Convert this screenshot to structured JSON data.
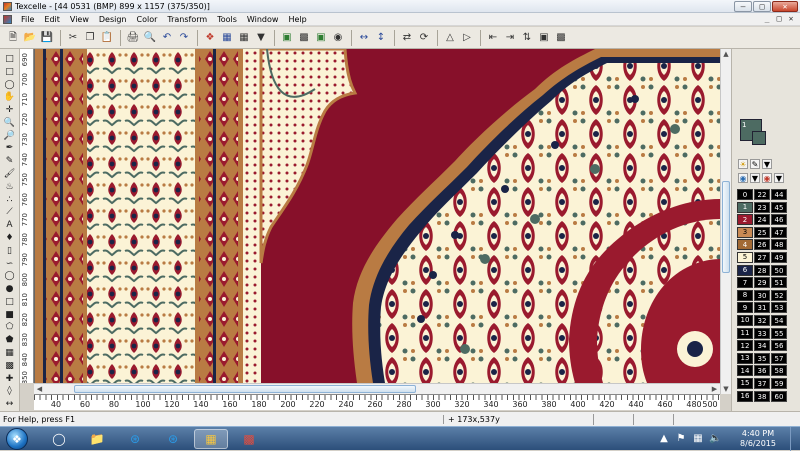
{
  "window": {
    "title": "Texcelle - [44 0531 (BMP) 899 x 1157 (375/350)]",
    "minimize_glyph": "—",
    "maximize_glyph": "□",
    "close_glyph": "✕"
  },
  "menu": {
    "items": [
      "File",
      "Edit",
      "View",
      "Design",
      "Color",
      "Transform",
      "Tools",
      "Window",
      "Help"
    ],
    "mdi_min": "_",
    "mdi_restore": "□",
    "mdi_close": "✕"
  },
  "vruler": {
    "labels": [
      "690",
      "700",
      "710",
      "720",
      "730",
      "740",
      "750",
      "760",
      "770",
      "780",
      "790",
      "800",
      "810",
      "820",
      "830",
      "840",
      "850"
    ]
  },
  "hruler": {
    "labels": [
      "40",
      "60",
      "80",
      "100",
      "120",
      "140",
      "160",
      "180",
      "200",
      "220",
      "240",
      "260",
      "280",
      "300",
      "320",
      "340",
      "360",
      "380",
      "400",
      "420",
      "440",
      "460",
      "480",
      "500"
    ]
  },
  "palette": {
    "current_index": "1",
    "colors": [
      {
        "idx": "0",
        "a": "22",
        "b": "44",
        "swatch": "#000000"
      },
      {
        "idx": "1",
        "a": "23",
        "b": "45",
        "swatch": "#4d6b62"
      },
      {
        "idx": "2",
        "a": "24",
        "b": "46",
        "swatch": "#9a1a2e"
      },
      {
        "idx": "3",
        "a": "25",
        "b": "47",
        "swatch": "#c98a54"
      },
      {
        "idx": "4",
        "a": "26",
        "b": "48",
        "swatch": "#a26a35"
      },
      {
        "idx": "5",
        "a": "27",
        "b": "49",
        "swatch": "#fbf3d6"
      },
      {
        "idx": "6",
        "a": "28",
        "b": "50",
        "swatch": "#1a2447"
      },
      {
        "idx": "7",
        "a": "29",
        "b": "51",
        "swatch": "#000000"
      },
      {
        "idx": "8",
        "a": "30",
        "b": "52",
        "swatch": "#000000"
      },
      {
        "idx": "9",
        "a": "31",
        "b": "53",
        "swatch": "#000000"
      },
      {
        "idx": "10",
        "a": "32",
        "b": "54",
        "swatch": "#000000"
      },
      {
        "idx": "11",
        "a": "33",
        "b": "55",
        "swatch": "#000000"
      },
      {
        "idx": "12",
        "a": "34",
        "b": "56",
        "swatch": "#000000"
      },
      {
        "idx": "13",
        "a": "35",
        "b": "57",
        "swatch": "#000000"
      },
      {
        "idx": "14",
        "a": "36",
        "b": "58",
        "swatch": "#000000"
      },
      {
        "idx": "15",
        "a": "37",
        "b": "59",
        "swatch": "#000000"
      },
      {
        "idx": "16",
        "a": "38",
        "b": "60",
        "swatch": "#000000"
      }
    ]
  },
  "status": {
    "help_text": "For Help, press F1",
    "coords": "+ 173x,537y"
  },
  "taskbar": {
    "time": "4:40 PM",
    "date": "8/6/2015"
  },
  "colors": {
    "field_red": "#87102a",
    "ivory": "#fbf3d6",
    "tan": "#b97b43",
    "teal": "#4d6b62",
    "navy": "#1a2447"
  }
}
